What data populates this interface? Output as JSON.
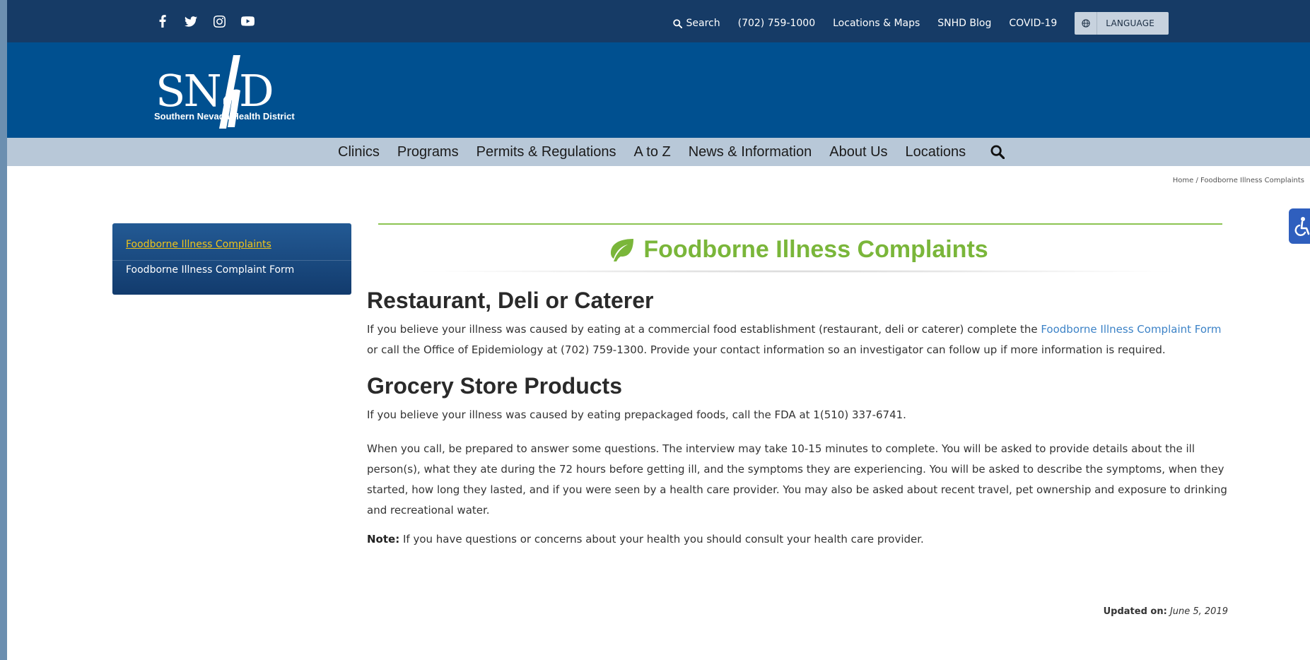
{
  "topbar": {
    "social": [
      "facebook-icon",
      "twitter-icon",
      "instagram-icon",
      "youtube-icon"
    ],
    "search_label": "Search",
    "phone": "(702) 759-1000",
    "locations_maps": "Locations & Maps",
    "blog": "SNHD Blog",
    "covid": "COVID-19",
    "language": "LANGUAGE"
  },
  "logo": {
    "letters": "SNhD",
    "subtitle": "Southern Nevada Health District"
  },
  "nav": {
    "items": [
      "Clinics",
      "Programs",
      "Permits & Regulations",
      "A to Z",
      "News & Information",
      "About Us",
      "Locations"
    ]
  },
  "breadcrumb": {
    "home": "Home",
    "separator": "/",
    "current": "Foodborne Illness Complaints"
  },
  "sidebar": {
    "items": [
      "Foodborne Illness Complaints",
      "Foodborne Illness Complaint Form"
    ]
  },
  "page": {
    "title": "Foodborne Illness Complaints",
    "section1_heading": "Restaurant, Deli or Caterer",
    "section1_text_a": "If you believe your illness was caused by eating at a commercial food establishment (restaurant, deli or caterer) complete the ",
    "section1_link": "Foodborne Illness Complaint Form",
    "section1_text_b": " or call the Office of Epidemiology at (702) 759-1300. Provide your contact information so an investigator can follow up if more information is required.",
    "section2_heading": "Grocery Store Products",
    "section2_text": "If you believe your illness was caused by eating prepackaged foods, call the FDA at 1(510) 337-6741.",
    "interview_text": "When you call, be prepared to answer some questions. The interview may take 10-15 minutes to complete. You will be asked to provide details about the ill person(s), what they ate during the 72 hours before getting ill, and the symptoms they are experiencing. You will be asked to describe the symptoms, when they started, how long they lasted, and if you were seen by a health care provider. You may also be asked about recent travel, pet ownership and exposure to drinking and recreational water.",
    "note_label": "Note:",
    "note_text": " If you have questions or concerns about your health you should consult your health care provider.",
    "updated_label": "Updated on:",
    "updated_date": "June 5, 2019"
  },
  "colors": {
    "topbar": "#163b66",
    "logoband": "#005090",
    "nav": "#b8c8d8",
    "title_green": "#7ab63a",
    "link_blue": "#3d83c7",
    "sidebar_active": "#f0c419"
  }
}
